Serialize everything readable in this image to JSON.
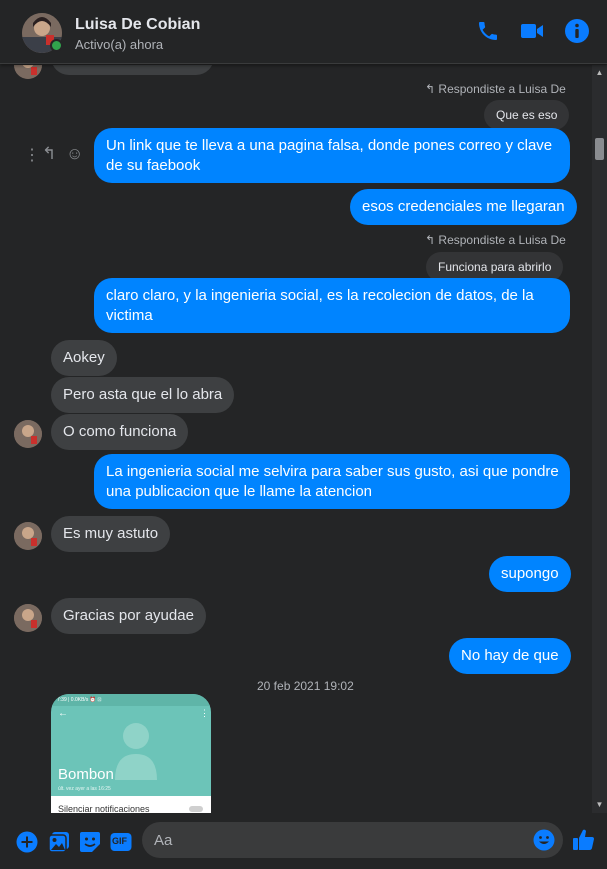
{
  "header": {
    "name": "Luisa De Cobian",
    "status": "Activo(a) ahora",
    "icons": [
      "phone-icon",
      "video-camera-icon",
      "info-icon"
    ]
  },
  "chat": {
    "reply_label": "Respondiste a Luisa De",
    "quoted_1": "Que es eso",
    "msg_1": "Un link que te lleva a una pagina falsa, donde pones correo y clave",
    "msg_1b": "de su faebook",
    "msg_2": "esos credenciales me llegaran",
    "quoted_2": "Funciona para abrirlo",
    "msg_3": "claro claro, y la ingenieria social, es la recolecion de datos, de la",
    "msg_3b": "victima",
    "msg_4": "Aokey",
    "msg_5": "Pero asta que el lo abra",
    "msg_6": "O como funciona",
    "msg_7": "La ingenieria social me selvira para saber sus gusto, asi que pondre",
    "msg_7b": "una publicacion que le llame la atencion",
    "msg_8": "Es muy astuto",
    "msg_9": "supongo",
    "msg_10": "Gracias por ayudae",
    "msg_11": "No hay de que",
    "timestamp": "20 feb 2021 19:02",
    "photo": {
      "status_text": "7:39 | 0.0KB/s ⏰ ⊡",
      "contact_name": "Bombon",
      "last_seen": "últ. vez ayer a las 16:25",
      "option": "Silenciar notificaciones"
    }
  },
  "composer": {
    "placeholder": "Aa",
    "gif_label": "GIF"
  },
  "colors": {
    "accent": "#0084ff",
    "background": "#242526",
    "incoming_bubble": "#3e4042",
    "online": "#31a24c"
  }
}
